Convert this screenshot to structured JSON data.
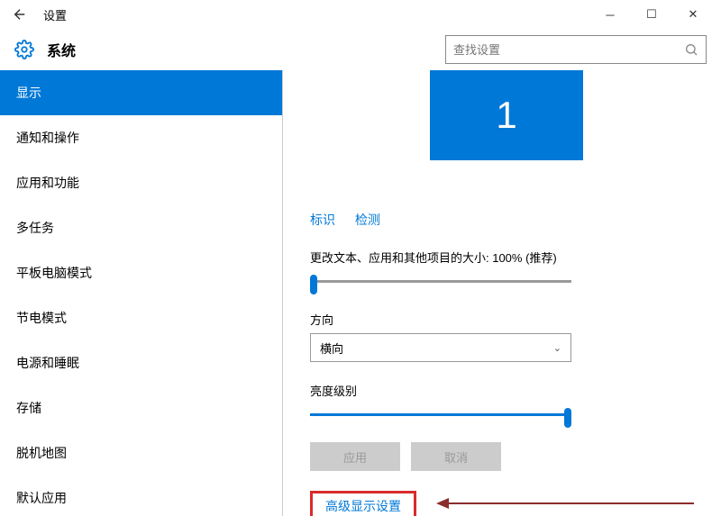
{
  "titlebar": {
    "title": "设置"
  },
  "header": {
    "section": "系统",
    "search_placeholder": "查找设置"
  },
  "sidebar": {
    "items": [
      {
        "label": "显示",
        "active": true
      },
      {
        "label": "通知和操作"
      },
      {
        "label": "应用和功能"
      },
      {
        "label": "多任务"
      },
      {
        "label": "平板电脑模式"
      },
      {
        "label": "节电模式"
      },
      {
        "label": "电源和睡眠"
      },
      {
        "label": "存储"
      },
      {
        "label": "脱机地图"
      },
      {
        "label": "默认应用"
      }
    ]
  },
  "display": {
    "monitor_number": "1",
    "identify": "标识",
    "detect": "检测",
    "scale_label": "更改文本、应用和其他项目的大小: 100% (推荐)",
    "orientation_label": "方向",
    "orientation_value": "横向",
    "brightness_label": "亮度级别",
    "apply": "应用",
    "cancel": "取消",
    "advanced": "高级显示设置"
  }
}
